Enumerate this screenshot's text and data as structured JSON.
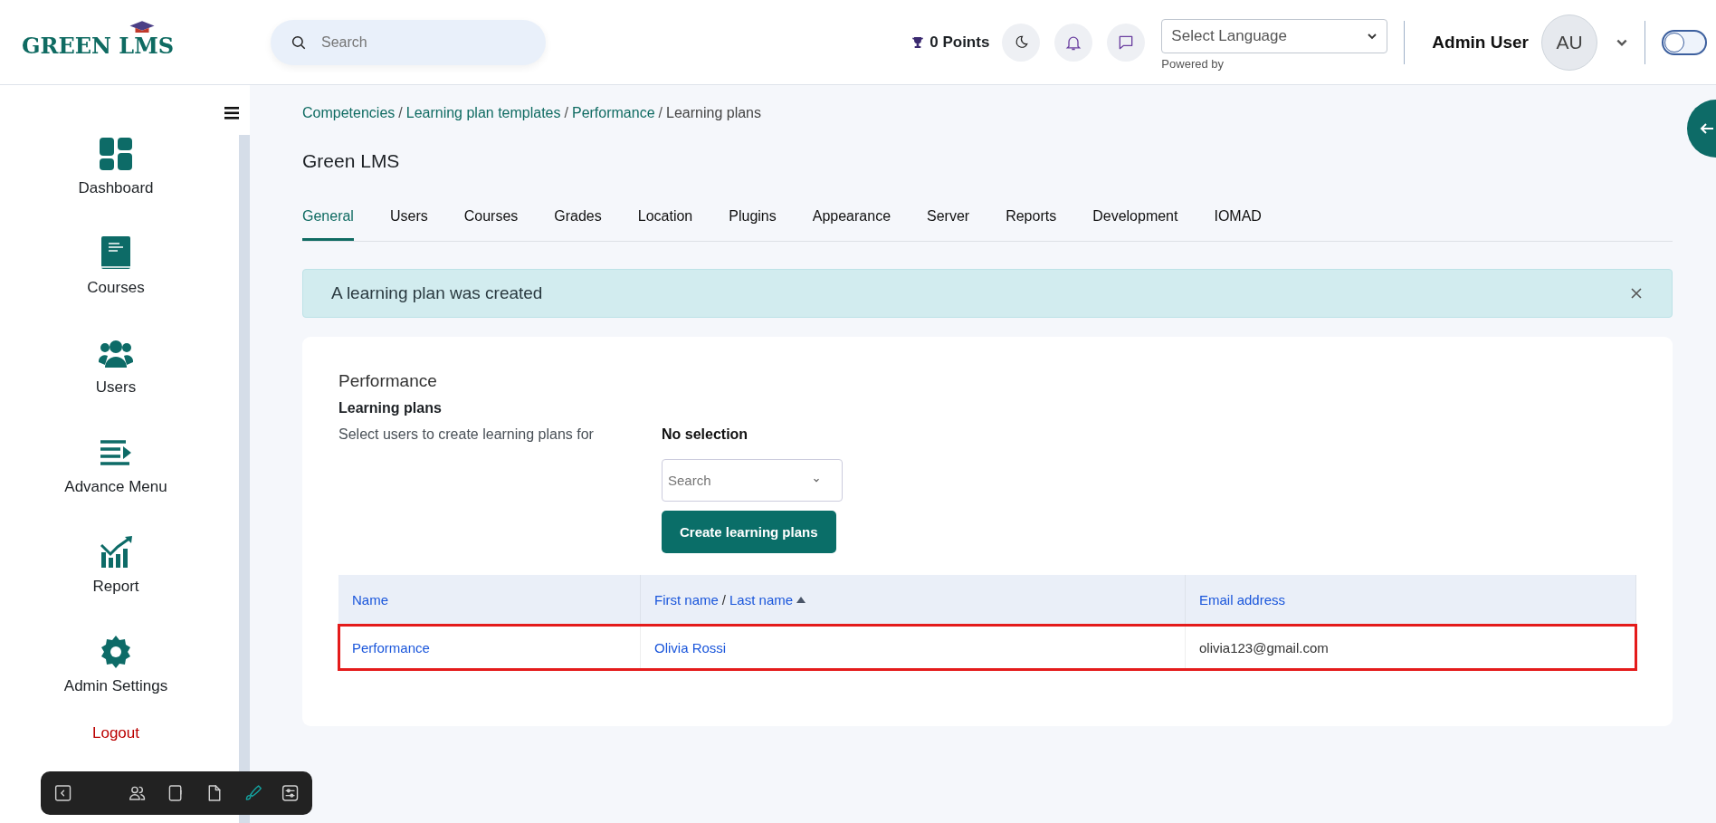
{
  "header": {
    "logo_text": "GREEN LMS",
    "search": {
      "placeholder": "Search"
    },
    "points": "0 Points",
    "language_select": {
      "placeholder": "Select Language",
      "note": "Powered by"
    },
    "user": {
      "name": "Admin User",
      "initials": "AU"
    },
    "toggle": {
      "on": false
    }
  },
  "sidebar": {
    "items": [
      {
        "label": "Dashboard"
      },
      {
        "label": "Courses"
      },
      {
        "label": "Users"
      },
      {
        "label": "Advance Menu"
      },
      {
        "label": "Report"
      },
      {
        "label": "Admin Settings"
      },
      {
        "label": "Logout"
      }
    ]
  },
  "breadcrumb": {
    "separator": "/",
    "items": [
      {
        "label": "Competencies",
        "link": true
      },
      {
        "label": "Learning plan templates",
        "link": true
      },
      {
        "label": "Performance",
        "link": true
      },
      {
        "label": "Learning plans",
        "link": false
      }
    ]
  },
  "page_title": "Green LMS",
  "tabs": [
    {
      "label": "General",
      "selected": true
    },
    {
      "label": "Users",
      "selected": false
    },
    {
      "label": "Courses",
      "selected": false
    },
    {
      "label": "Grades",
      "selected": false
    },
    {
      "label": "Location",
      "selected": false
    },
    {
      "label": "Plugins",
      "selected": false
    },
    {
      "label": "Appearance",
      "selected": false
    },
    {
      "label": "Server",
      "selected": false
    },
    {
      "label": "Reports",
      "selected": false
    },
    {
      "label": "Development",
      "selected": false
    },
    {
      "label": "IOMAD",
      "selected": false
    }
  ],
  "alert": {
    "message": "A learning plan was created"
  },
  "card": {
    "title": "Performance",
    "subtitle": "Learning plans",
    "form_label": "Select users to create learning plans for",
    "selection": "No selection",
    "user_search": {
      "placeholder": "Search"
    },
    "button": "Create learning plans",
    "table": {
      "header_separator": "/",
      "columns": [
        {
          "labels": [
            "Name"
          ],
          "sorted": false
        },
        {
          "labels": [
            "First name",
            "Last name"
          ],
          "sorted": true
        },
        {
          "labels": [
            "Email address"
          ],
          "sorted": false
        }
      ],
      "rows": [
        {
          "outlined": true,
          "cells": [
            {
              "text": "Performance",
              "link": true
            },
            {
              "text": "Olivia Rossi",
              "link": true
            },
            {
              "text": "olivia123@gmail.com",
              "link": false
            }
          ]
        }
      ]
    }
  },
  "toolbar": [
    {
      "selected": false
    },
    {
      "selected": false
    },
    {
      "selected": false
    },
    {
      "selected": false
    },
    {
      "selected": true
    },
    {
      "selected": false
    }
  ]
}
